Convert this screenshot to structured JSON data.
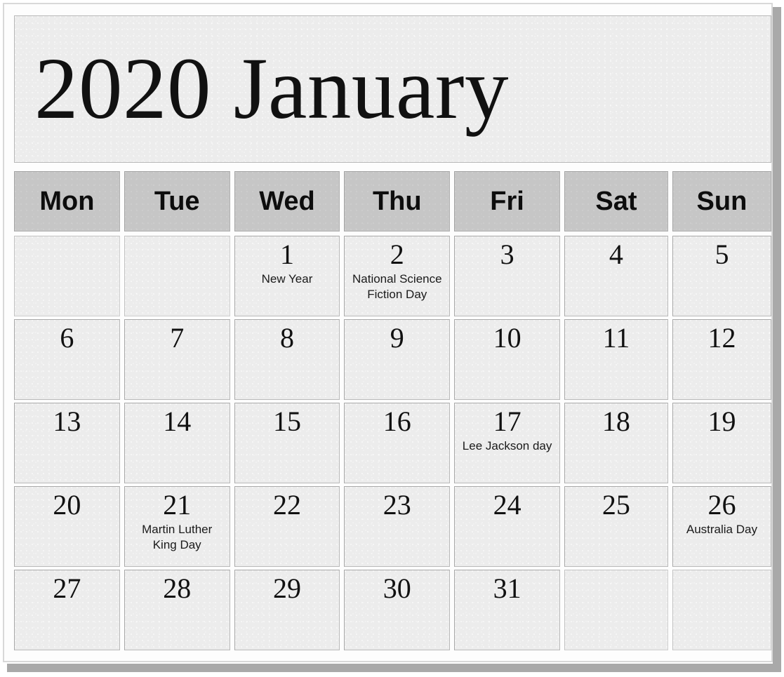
{
  "calendar": {
    "title": "2020 January",
    "year": "2020",
    "month": "January",
    "weekdays": [
      "Mon",
      "Tue",
      "Wed",
      "Thu",
      "Fri",
      "Sat",
      "Sun"
    ],
    "colors": {
      "page_background": "#ffffff",
      "cell_background": "#ececec",
      "weekday_header_background": "#c6c6c6",
      "cell_border": "#b9b9b9",
      "text": "#111111",
      "shadow": "#a9a9a9"
    },
    "weeks": [
      [
        {
          "day": "",
          "event": ""
        },
        {
          "day": "",
          "event": ""
        },
        {
          "day": "1",
          "event": "New Year"
        },
        {
          "day": "2",
          "event": "National Science Fiction Day"
        },
        {
          "day": "3",
          "event": ""
        },
        {
          "day": "4",
          "event": ""
        },
        {
          "day": "5",
          "event": ""
        }
      ],
      [
        {
          "day": "6",
          "event": ""
        },
        {
          "day": "7",
          "event": ""
        },
        {
          "day": "8",
          "event": ""
        },
        {
          "day": "9",
          "event": ""
        },
        {
          "day": "10",
          "event": ""
        },
        {
          "day": "11",
          "event": ""
        },
        {
          "day": "12",
          "event": ""
        }
      ],
      [
        {
          "day": "13",
          "event": ""
        },
        {
          "day": "14",
          "event": ""
        },
        {
          "day": "15",
          "event": ""
        },
        {
          "day": "16",
          "event": ""
        },
        {
          "day": "17",
          "event": "Lee Jackson day"
        },
        {
          "day": "18",
          "event": ""
        },
        {
          "day": "19",
          "event": ""
        }
      ],
      [
        {
          "day": "20",
          "event": ""
        },
        {
          "day": "21",
          "event": "Martin Luther King Day"
        },
        {
          "day": "22",
          "event": ""
        },
        {
          "day": "23",
          "event": ""
        },
        {
          "day": "24",
          "event": ""
        },
        {
          "day": "25",
          "event": ""
        },
        {
          "day": "26",
          "event": "Australia Day"
        }
      ],
      [
        {
          "day": "27",
          "event": ""
        },
        {
          "day": "28",
          "event": ""
        },
        {
          "day": "29",
          "event": ""
        },
        {
          "day": "30",
          "event": ""
        },
        {
          "day": "31",
          "event": ""
        },
        {
          "day": "",
          "event": ""
        },
        {
          "day": "",
          "event": ""
        }
      ]
    ]
  }
}
